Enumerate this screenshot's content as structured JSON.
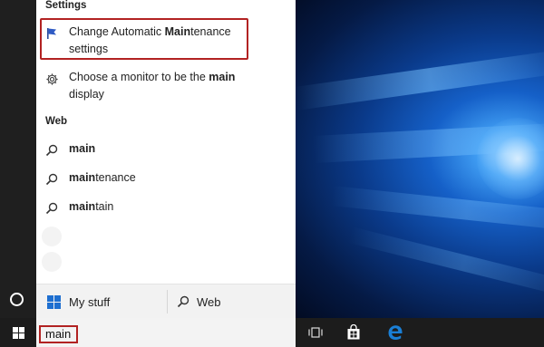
{
  "settings": {
    "header": "Settings",
    "items": [
      {
        "icon": "flag-icon",
        "lines": [
          {
            "pre": "Change Automatic ",
            "bold": "Main",
            "post": "tenance"
          },
          {
            "pre": "settings",
            "bold": "",
            "post": ""
          }
        ]
      },
      {
        "icon": "gear-icon",
        "lines": [
          {
            "pre": "Choose a monitor to be the ",
            "bold": "main",
            "post": ""
          },
          {
            "pre": "display",
            "bold": "",
            "post": ""
          }
        ]
      }
    ]
  },
  "web": {
    "header": "Web",
    "items": [
      {
        "icon": "search-icon",
        "bold": "main",
        "post": ""
      },
      {
        "icon": "search-icon",
        "bold": "main",
        "post": "tenance"
      },
      {
        "icon": "search-icon",
        "bold": "main",
        "post": "tain"
      }
    ]
  },
  "bottom": {
    "my_stuff_label": "My stuff",
    "web_label": "Web"
  },
  "taskbar": {
    "search_text": "main",
    "icons": [
      "task-view-icon",
      "store-icon",
      "edge-icon"
    ]
  },
  "colors": {
    "highlight_border": "#b22222",
    "accent_blue": "#1e6fd0",
    "edge_blue": "#1a7fd6"
  }
}
